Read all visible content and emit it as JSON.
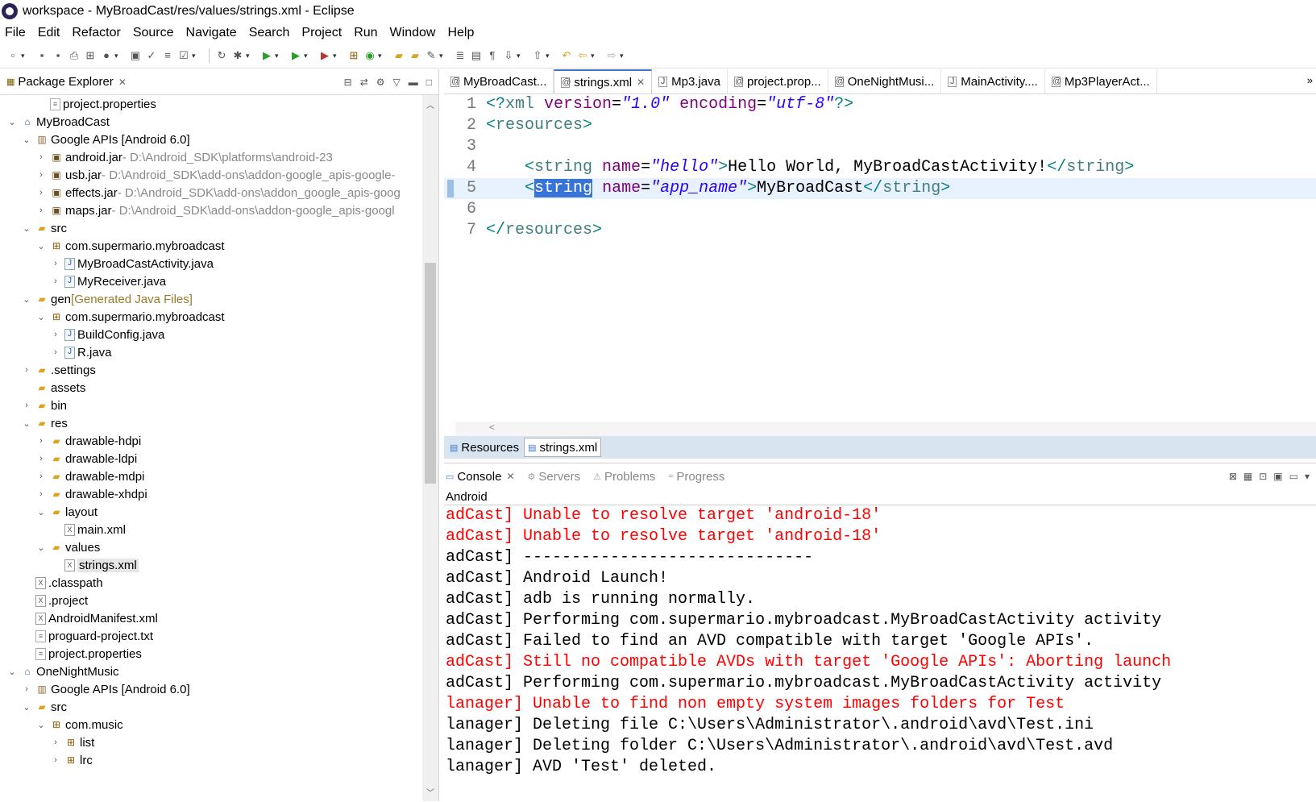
{
  "window": {
    "title": "workspace - MyBroadCast/res/values/strings.xml - Eclipse"
  },
  "menu": [
    "File",
    "Edit",
    "Refactor",
    "Source",
    "Navigate",
    "Search",
    "Project",
    "Run",
    "Window",
    "Help"
  ],
  "package_explorer": {
    "title": "Package Explorer",
    "tree": [
      {
        "depth": 2,
        "twisty": "",
        "icon": "props",
        "label": "project.properties",
        "extra": "",
        "cls": ""
      },
      {
        "depth": 0,
        "twisty": "v",
        "icon": "project",
        "label": "MyBroadCast",
        "extra": "",
        "cls": ""
      },
      {
        "depth": 1,
        "twisty": "v",
        "icon": "lib",
        "label": "Google APIs [Android 6.0]",
        "extra": "",
        "cls": ""
      },
      {
        "depth": 2,
        "twisty": ">",
        "icon": "jar",
        "label": "android.jar",
        "extra": " - D:\\Android_SDK\\platforms\\android-23",
        "cls": ""
      },
      {
        "depth": 2,
        "twisty": ">",
        "icon": "jar",
        "label": "usb.jar",
        "extra": " - D:\\Android_SDK\\add-ons\\addon-google_apis-google-",
        "cls": ""
      },
      {
        "depth": 2,
        "twisty": ">",
        "icon": "jar",
        "label": "effects.jar",
        "extra": " - D:\\Android_SDK\\add-ons\\addon_google_apis-goog",
        "cls": ""
      },
      {
        "depth": 2,
        "twisty": ">",
        "icon": "jar",
        "label": "maps.jar",
        "extra": " - D:\\Android_SDK\\add-ons\\addon-google_apis-googl",
        "cls": ""
      },
      {
        "depth": 1,
        "twisty": "v",
        "icon": "folder",
        "label": "src",
        "extra": "",
        "cls": ""
      },
      {
        "depth": 2,
        "twisty": "v",
        "icon": "pkg",
        "label": "com.supermario.mybroadcast",
        "extra": "",
        "cls": ""
      },
      {
        "depth": 3,
        "twisty": ">",
        "icon": "java",
        "label": "MyBroadCastActivity.java",
        "extra": "",
        "cls": ""
      },
      {
        "depth": 3,
        "twisty": ">",
        "icon": "java",
        "label": "MyReceiver.java",
        "extra": "",
        "cls": ""
      },
      {
        "depth": 1,
        "twisty": "v",
        "icon": "folder",
        "label": "gen",
        "extra": " [Generated Java Files]",
        "cls": "gen"
      },
      {
        "depth": 2,
        "twisty": "v",
        "icon": "pkg",
        "label": "com.supermario.mybroadcast",
        "extra": "",
        "cls": ""
      },
      {
        "depth": 3,
        "twisty": ">",
        "icon": "java",
        "label": "BuildConfig.java",
        "extra": "",
        "cls": ""
      },
      {
        "depth": 3,
        "twisty": ">",
        "icon": "java",
        "label": "R.java",
        "extra": "",
        "cls": ""
      },
      {
        "depth": 1,
        "twisty": ">",
        "icon": "folder",
        "label": ".settings",
        "extra": "",
        "cls": ""
      },
      {
        "depth": 1,
        "twisty": "",
        "icon": "folder",
        "label": "assets",
        "extra": "",
        "cls": ""
      },
      {
        "depth": 1,
        "twisty": ">",
        "icon": "folder",
        "label": "bin",
        "extra": "",
        "cls": ""
      },
      {
        "depth": 1,
        "twisty": "v",
        "icon": "folder",
        "label": "res",
        "extra": "",
        "cls": ""
      },
      {
        "depth": 2,
        "twisty": ">",
        "icon": "folder",
        "label": "drawable-hdpi",
        "extra": "",
        "cls": ""
      },
      {
        "depth": 2,
        "twisty": ">",
        "icon": "folder",
        "label": "drawable-ldpi",
        "extra": "",
        "cls": ""
      },
      {
        "depth": 2,
        "twisty": ">",
        "icon": "folder",
        "label": "drawable-mdpi",
        "extra": "",
        "cls": ""
      },
      {
        "depth": 2,
        "twisty": ">",
        "icon": "folder",
        "label": "drawable-xhdpi",
        "extra": "",
        "cls": ""
      },
      {
        "depth": 2,
        "twisty": "v",
        "icon": "folder",
        "label": "layout",
        "extra": "",
        "cls": ""
      },
      {
        "depth": 3,
        "twisty": "",
        "icon": "xml",
        "label": "main.xml",
        "extra": "",
        "cls": ""
      },
      {
        "depth": 2,
        "twisty": "v",
        "icon": "folder",
        "label": "values",
        "extra": "",
        "cls": ""
      },
      {
        "depth": 3,
        "twisty": "",
        "icon": "xml",
        "label": "strings.xml",
        "extra": "",
        "cls": "selected"
      },
      {
        "depth": 1,
        "twisty": "",
        "icon": "xml",
        "label": ".classpath",
        "extra": "",
        "cls": ""
      },
      {
        "depth": 1,
        "twisty": "",
        "icon": "xml",
        "label": ".project",
        "extra": "",
        "cls": ""
      },
      {
        "depth": 1,
        "twisty": "",
        "icon": "xml",
        "label": "AndroidManifest.xml",
        "extra": "",
        "cls": ""
      },
      {
        "depth": 1,
        "twisty": "",
        "icon": "props",
        "label": "proguard-project.txt",
        "extra": "",
        "cls": ""
      },
      {
        "depth": 1,
        "twisty": "",
        "icon": "props",
        "label": "project.properties",
        "extra": "",
        "cls": ""
      },
      {
        "depth": 0,
        "twisty": "v",
        "icon": "project",
        "label": "OneNightMusic",
        "extra": "",
        "cls": ""
      },
      {
        "depth": 1,
        "twisty": ">",
        "icon": "lib",
        "label": "Google APIs [Android 6.0]",
        "extra": "",
        "cls": ""
      },
      {
        "depth": 1,
        "twisty": "v",
        "icon": "folder",
        "label": "src",
        "extra": "",
        "cls": ""
      },
      {
        "depth": 2,
        "twisty": "v",
        "icon": "pkg",
        "label": "com.music",
        "extra": "",
        "cls": ""
      },
      {
        "depth": 3,
        "twisty": ">",
        "icon": "pkg",
        "label": "list",
        "extra": "",
        "cls": ""
      },
      {
        "depth": 3,
        "twisty": ">",
        "icon": "pkg",
        "label": "lrc",
        "extra": "",
        "cls": ""
      }
    ]
  },
  "editor": {
    "tabs": [
      {
        "label": "MyBroadCast...",
        "active": false
      },
      {
        "label": "strings.xml",
        "active": true
      },
      {
        "label": "Mp3.java",
        "active": false
      },
      {
        "label": "project.prop...",
        "active": false
      },
      {
        "label": "OneNightMusi...",
        "active": false
      },
      {
        "label": "MainActivity....",
        "active": false
      },
      {
        "label": "Mp3PlayerAct...",
        "active": false
      }
    ],
    "overflow": "»",
    "lines": [
      {
        "n": "1",
        "tokens": [
          [
            "t-br",
            "<?"
          ],
          [
            "t-tag",
            "xml "
          ],
          [
            "t-attr",
            "version"
          ],
          [
            "t-txt",
            "="
          ],
          [
            "t-val",
            "\"1.0\""
          ],
          [
            "t-txt",
            " "
          ],
          [
            "t-attr",
            "encoding"
          ],
          [
            "t-txt",
            "="
          ],
          [
            "t-val",
            "\"utf-8\""
          ],
          [
            "t-br",
            "?>"
          ]
        ]
      },
      {
        "n": "2",
        "tokens": [
          [
            "t-br",
            "<"
          ],
          [
            "t-tag",
            "resources"
          ],
          [
            "t-br",
            ">"
          ]
        ]
      },
      {
        "n": "3",
        "tokens": []
      },
      {
        "n": "4",
        "tokens": [
          [
            "t-txt",
            "    "
          ],
          [
            "t-br",
            "<"
          ],
          [
            "t-tag",
            "string "
          ],
          [
            "t-attr",
            "name"
          ],
          [
            "t-txt",
            "="
          ],
          [
            "t-val",
            "\"hello\""
          ],
          [
            "t-br",
            ">"
          ],
          [
            "t-txt",
            "Hello World, MyBroadCastActivity!"
          ],
          [
            "t-br",
            "</"
          ],
          [
            "t-tag",
            "string"
          ],
          [
            "t-br",
            ">"
          ]
        ]
      },
      {
        "n": "5",
        "tokens": [
          [
            "t-txt",
            "    "
          ],
          [
            "t-br",
            "<"
          ],
          [
            "sel",
            "string"
          ],
          [
            "t-txt",
            " "
          ],
          [
            "t-attr",
            "name"
          ],
          [
            "t-txt",
            "="
          ],
          [
            "t-val",
            "\"app_name\""
          ],
          [
            "t-br",
            ">"
          ],
          [
            "t-txt",
            "MyBroadCast"
          ],
          [
            "t-br",
            "</"
          ],
          [
            "t-tag",
            "string"
          ],
          [
            "t-br",
            ">"
          ]
        ],
        "current": true
      },
      {
        "n": "6",
        "tokens": []
      },
      {
        "n": "7",
        "tokens": [
          [
            "t-br",
            "</"
          ],
          [
            "t-tag",
            "resources"
          ],
          [
            "t-br",
            ">"
          ]
        ]
      }
    ],
    "subtabs": [
      {
        "label": "Resources",
        "active": false
      },
      {
        "label": "strings.xml",
        "active": true
      }
    ]
  },
  "console": {
    "tabs": [
      {
        "label": "Console",
        "active": true
      },
      {
        "label": "Servers",
        "active": false
      },
      {
        "label": "Problems",
        "active": false
      },
      {
        "label": "Progress",
        "active": false
      }
    ],
    "name": "Android",
    "lines": [
      {
        "t": "adCast] Unable to resolve target 'android-18'",
        "err": true
      },
      {
        "t": "adCast] Unable to resolve target 'android-18'",
        "err": true
      },
      {
        "t": "adCast] ------------------------------",
        "err": false
      },
      {
        "t": "adCast] Android Launch!",
        "err": false
      },
      {
        "t": "adCast] adb is running normally.",
        "err": false
      },
      {
        "t": "adCast] Performing com.supermario.mybroadcast.MyBroadCastActivity activity",
        "err": false
      },
      {
        "t": "adCast] Failed to find an AVD compatible with target 'Google APIs'.",
        "err": false
      },
      {
        "t": "adCast] Still no compatible AVDs with target 'Google APIs': Aborting launch",
        "err": true
      },
      {
        "t": "adCast] Performing com.supermario.mybroadcast.MyBroadCastActivity activity",
        "err": false
      },
      {
        "t": "lanager] Unable to find non empty system images folders for Test",
        "err": true
      },
      {
        "t": "lanager] Deleting file C:\\Users\\Administrator\\.android\\avd\\Test.ini",
        "err": false
      },
      {
        "t": "lanager] Deleting folder C:\\Users\\Administrator\\.android\\avd\\Test.avd",
        "err": false
      },
      {
        "t": "lanager] AVD 'Test' deleted.",
        "err": false
      }
    ]
  }
}
